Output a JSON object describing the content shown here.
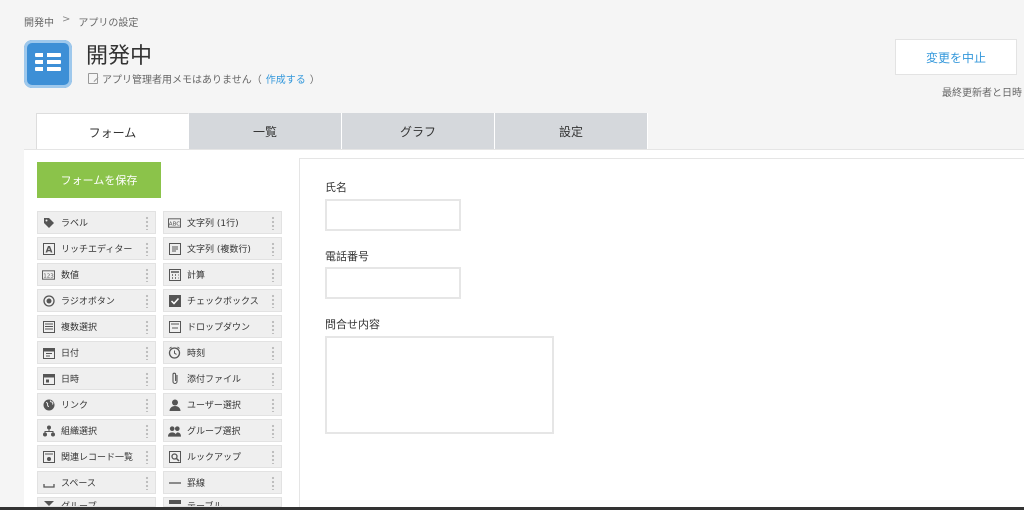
{
  "breadcrumb": {
    "parent": "開発中",
    "separator": ">",
    "current": "アプリの設定"
  },
  "app": {
    "title": "開発中",
    "memo_text": "アプリ管理者用メモはありません（",
    "memo_link": "作成する",
    "memo_end": "）"
  },
  "header": {
    "stop_label": "変更を中止",
    "updated_label": "最終更新者と日時"
  },
  "tabs": [
    {
      "label": "フォーム",
      "active": true
    },
    {
      "label": "一覧"
    },
    {
      "label": "グラフ"
    },
    {
      "label": "設定"
    }
  ],
  "save_label": "フォームを保存",
  "palette": [
    {
      "label": "ラベル",
      "icon": "tag-icon"
    },
    {
      "label": "文字列 (1行)",
      "icon": "abc-icon"
    },
    {
      "label": "リッチエディター",
      "icon": "rich-text-icon"
    },
    {
      "label": "文字列 (複数行)",
      "icon": "multiline-icon"
    },
    {
      "label": "数値",
      "icon": "number-icon"
    },
    {
      "label": "計算",
      "icon": "calculator-icon"
    },
    {
      "label": "ラジオボタン",
      "icon": "radio-icon"
    },
    {
      "label": "チェックボックス",
      "icon": "checkbox-icon"
    },
    {
      "label": "複数選択",
      "icon": "multiselect-icon"
    },
    {
      "label": "ドロップダウン",
      "icon": "dropdown-icon"
    },
    {
      "label": "日付",
      "icon": "calendar-icon"
    },
    {
      "label": "時刻",
      "icon": "clock-icon"
    },
    {
      "label": "日時",
      "icon": "datetime-icon"
    },
    {
      "label": "添付ファイル",
      "icon": "paperclip-icon"
    },
    {
      "label": "リンク",
      "icon": "globe-icon"
    },
    {
      "label": "ユーザー選択",
      "icon": "user-icon"
    },
    {
      "label": "組織選択",
      "icon": "org-icon"
    },
    {
      "label": "グループ選択",
      "icon": "group-icon"
    },
    {
      "label": "関連レコード一覧",
      "icon": "related-records-icon"
    },
    {
      "label": "ルックアップ",
      "icon": "lookup-icon"
    },
    {
      "label": "スペース",
      "icon": "space-icon"
    },
    {
      "label": "罫線",
      "icon": "line-icon"
    },
    {
      "label": "グループ",
      "icon": "group-field-icon"
    },
    {
      "label": "テーブル",
      "icon": "table-icon"
    }
  ],
  "form_fields": [
    {
      "label": "氏名"
    },
    {
      "label": "電話番号"
    },
    {
      "label": "問合せ内容"
    }
  ],
  "colors": {
    "accent": "#3498db",
    "save": "#8bc34a",
    "app_icon": "#3d8fd6"
  }
}
